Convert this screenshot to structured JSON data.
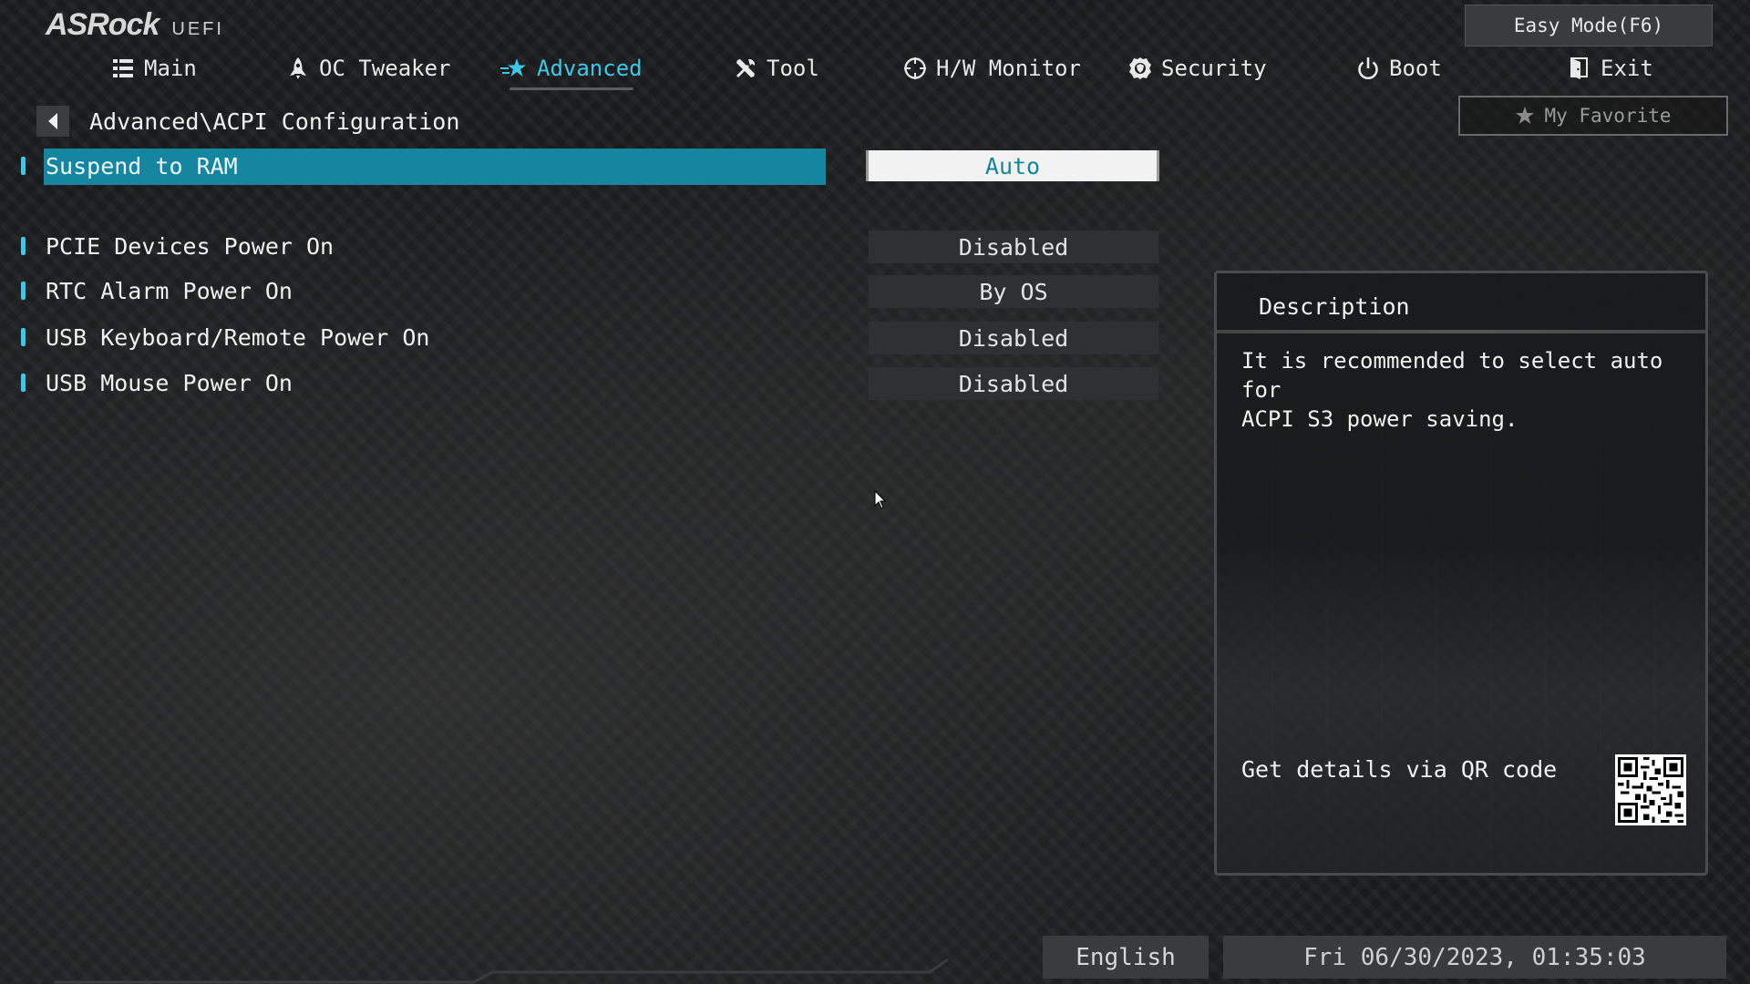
{
  "logo": {
    "brand": "ASRock",
    "product": "UEFI"
  },
  "easy_mode": {
    "label": "Easy Mode(F6)"
  },
  "nav": {
    "items": [
      {
        "label": "Main",
        "icon": "list-icon"
      },
      {
        "label": "OC Tweaker",
        "icon": "rocket-icon"
      },
      {
        "label": "Advanced",
        "icon": "star-icon",
        "active": true
      },
      {
        "label": "Tool",
        "icon": "tools-icon"
      },
      {
        "label": "H/W Monitor",
        "icon": "crosshair-icon"
      },
      {
        "label": "Security",
        "icon": "shield-icon"
      },
      {
        "label": "Boot",
        "icon": "power-icon"
      },
      {
        "label": "Exit",
        "icon": "exit-door-icon"
      }
    ]
  },
  "breadcrumb": {
    "path": "Advanced\\ACPI Configuration"
  },
  "favorite": {
    "label": "My Favorite",
    "icon": "star-icon"
  },
  "settings": [
    {
      "label": "Suspend to RAM",
      "value": "Auto",
      "selected": true
    },
    {
      "label": "PCIE Devices Power On",
      "value": "Disabled"
    },
    {
      "label": "RTC Alarm Power On",
      "value": "By OS"
    },
    {
      "label": "USB Keyboard/Remote Power On",
      "value": "Disabled"
    },
    {
      "label": "USB Mouse Power On",
      "value": "Disabled"
    }
  ],
  "description": {
    "title": "Description",
    "text": "It is recommended to select auto for\nACPI S3 power saving.",
    "qr_label": "Get details via QR code"
  },
  "footer": {
    "language": "English",
    "datetime": "Fri 06/30/2023, 01:35:03"
  },
  "colors": {
    "accent": "#3ec8e8",
    "selected_bg": "#1686a0",
    "background": "#1c1d1e"
  }
}
